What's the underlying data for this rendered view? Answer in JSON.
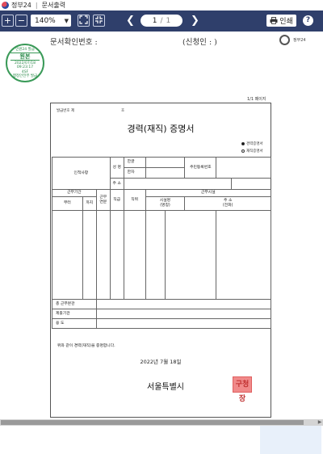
{
  "window": {
    "app_name": "정부24",
    "title": "문서출력"
  },
  "toolbar": {
    "zoom_in_icon": "+",
    "zoom_out_icon": "−",
    "zoom_value": "140%",
    "page_current": "1",
    "page_total": "1",
    "print_label": "인쇄",
    "help_label": "?"
  },
  "header": {
    "doc_number_label": "문서확인번호 :",
    "applicant_label": "(신청인 :          )",
    "stamp": {
      "top": "민원24 발급",
      "mid": "원본",
      "date": "2022/07/18",
      "time": "09:23:17",
      "code": "4SF",
      "bottom": "행정안전부 발급"
    },
    "logo_text": "정부24",
    "page_count": "1/1 페이지"
  },
  "document": {
    "top_left": "발급번호 제",
    "top_mid": "호",
    "title": "경력(재직) 증명서",
    "option_career": "경력증명서",
    "option_employment": "재직증명서",
    "rows": {
      "personal": "인적사항",
      "name": "성 명",
      "korean": "한글",
      "hanja": "한자",
      "resident_no": "주민등록번호",
      "address": "주 소",
      "period": "근무기간",
      "from": "부터",
      "to": "까지",
      "years": "근무\n연분",
      "position": "직급",
      "job": "직위",
      "workplace": "근무시설",
      "facility_name": "시설명\n(명칭)",
      "facility_address": "주 소\n(전화)",
      "total": "총 근무본관",
      "submit_to": "제출기관",
      "purpose": "용 도"
    },
    "confirm": "위와 같이 경력(재직)을 증명합니다.",
    "date": "2022년 7월 18일",
    "issuer": "서울특별시",
    "seal": "구청장"
  }
}
